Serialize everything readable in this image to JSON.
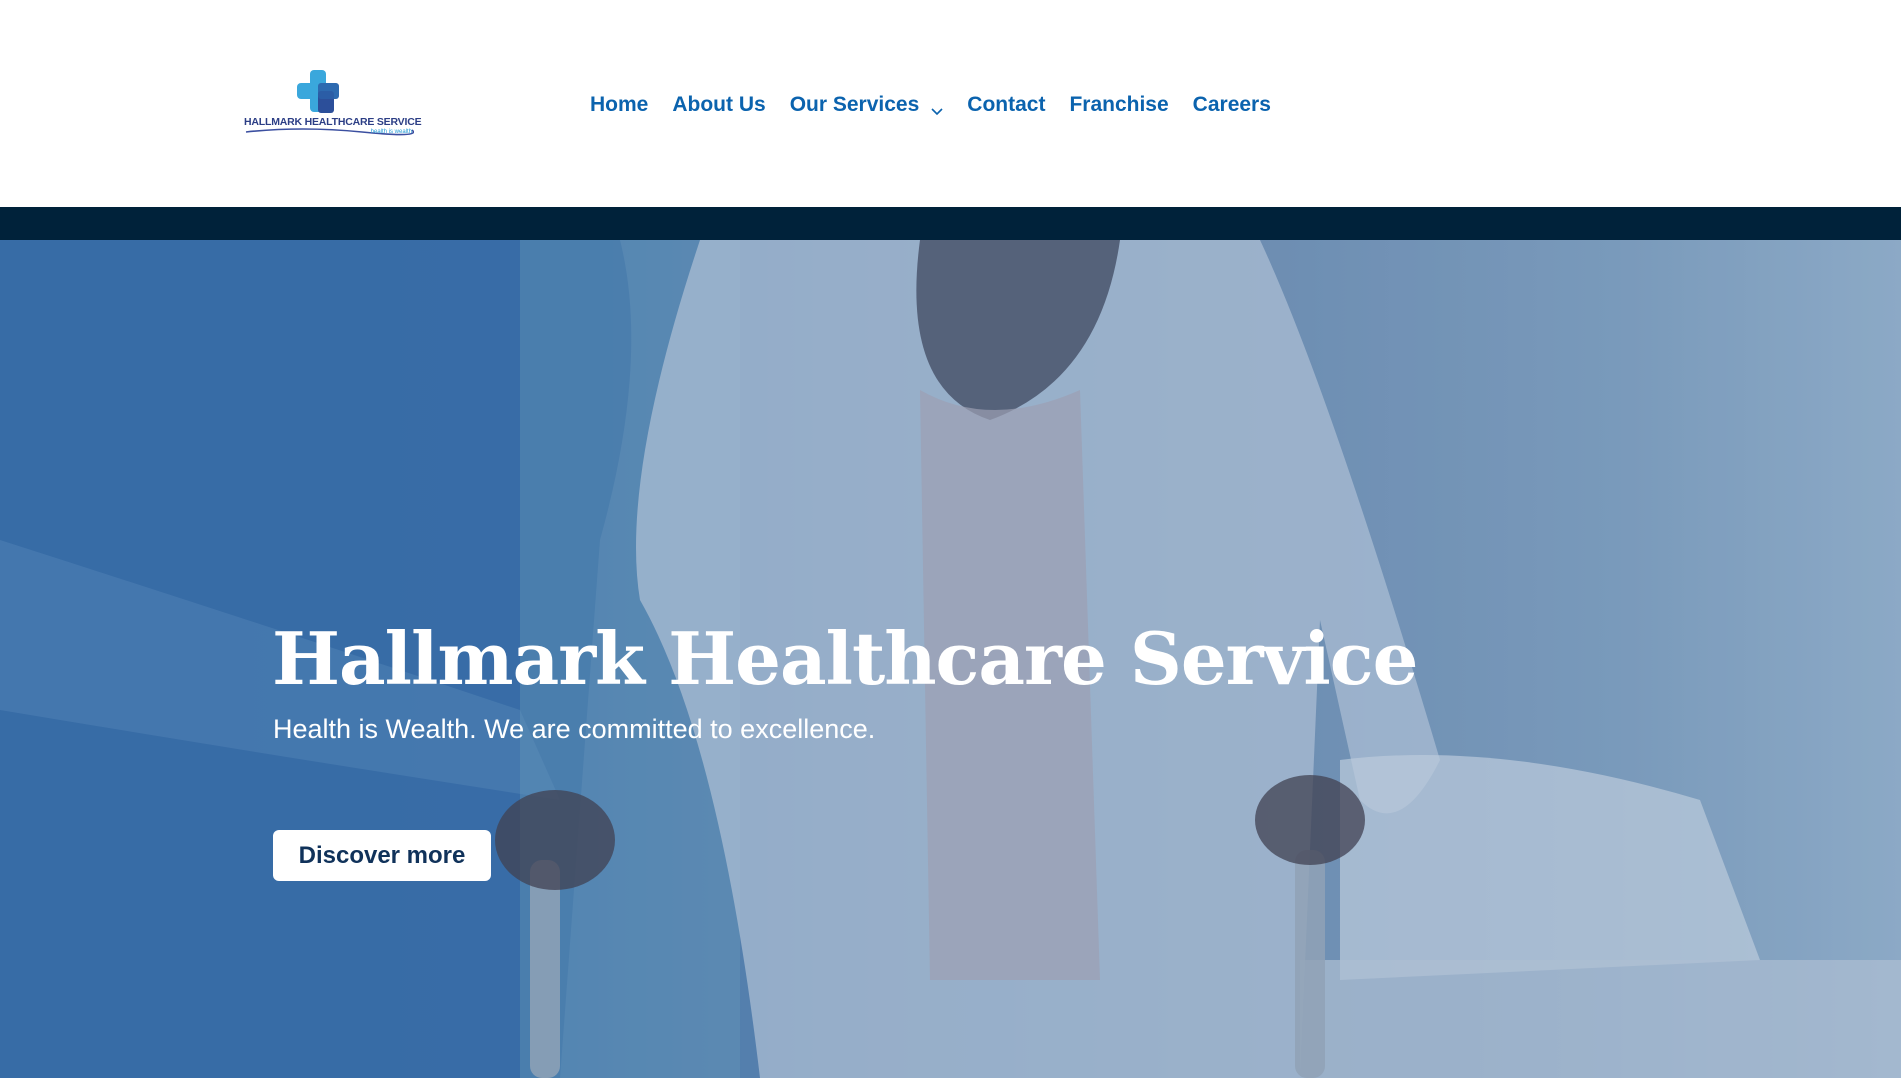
{
  "header": {
    "logo": {
      "name": "HALLMARK HEALTHCARE SERVICE",
      "tagline": "health is wealth",
      "icon": "medical-cross-icon"
    },
    "nav": [
      {
        "label": "Home"
      },
      {
        "label": "About Us"
      },
      {
        "label": "Our Services",
        "has_dropdown": true,
        "icon": "chevron-down-icon"
      },
      {
        "label": "Contact"
      },
      {
        "label": "Franchise"
      },
      {
        "label": "Careers"
      }
    ]
  },
  "hero": {
    "title": "Hallmark Healthcare Service",
    "subtitle": "Health is Wealth. We are committed to excellence.",
    "cta_label": "Discover more"
  },
  "colors": {
    "nav_text": "#0b63ae",
    "dark_bar": "#00223a",
    "hero_overlay": "#3f78b4",
    "button_text": "#10325a"
  }
}
